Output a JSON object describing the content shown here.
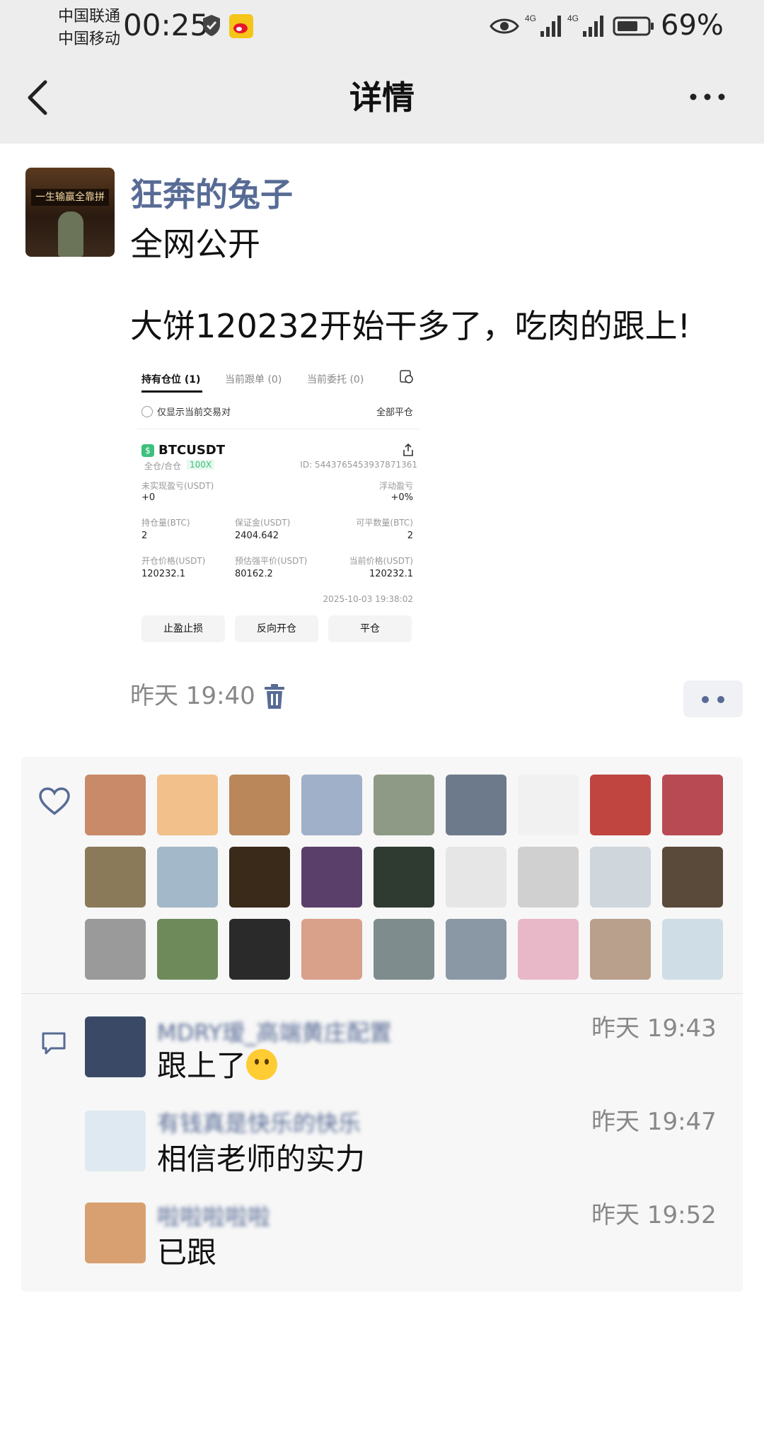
{
  "status_bar": {
    "carrier_1": "中国联通",
    "carrier_2": "中国移动",
    "time": "00:25",
    "network_1": "4G",
    "network_2": "4G",
    "battery": "69%"
  },
  "header": {
    "title": "详情"
  },
  "post": {
    "author": "狂奔的兔子",
    "avatar_sign_text": "一生输赢全靠拼",
    "visibility": "全网公开",
    "text": "大饼120232开始干多了，吃肉的跟上!",
    "time": "昨天 19:40"
  },
  "trade_screenshot": {
    "tabs": [
      "持有仓位 (1)",
      "当前跟单 (0)",
      "当前委托 (0)"
    ],
    "only_current_pair": "仅显示当前交易对",
    "close_all": "全部平仓",
    "symbol": "BTCUSDT",
    "margin_mode": "全仓/合仓",
    "leverage": "100X",
    "position_id": "ID: 5443765453937871361",
    "unrealized_pnl_label": "未实现盈亏(USDT)",
    "unrealized_pnl_value": "+0",
    "floating_pnl_label": "浮动盈亏",
    "floating_pnl_value": "+0%",
    "position_size_label": "持仓量(BTC)",
    "position_size_value": "2",
    "margin_label": "保证金(USDT)",
    "margin_value": "2404.642",
    "closable_label": "可平数量(BTC)",
    "closable_value": "2",
    "entry_price_label": "开仓价格(USDT)",
    "entry_price_value": "120232.1",
    "liq_price_label": "预估强平价(USDT)",
    "liq_price_value": "80162.2",
    "mark_price_label": "当前价格(USDT)",
    "mark_price_value": "120232.1",
    "timestamp": "2025-10-03 19:38:02",
    "buttons": [
      "止盈止损",
      "反向开仓",
      "平仓"
    ]
  },
  "likes": {
    "avatar_colors": [
      "#c98a6a",
      "#f2c08a",
      "#b9875a",
      "#9fb0c8",
      "#8f9a86",
      "#6d7a8c",
      "#f1f1f1",
      "#c0443f",
      "#b84a54",
      "#8a7a5a",
      "#a3b8c8",
      "#3a2a1a",
      "#5b3f6b",
      "#2f3a30",
      "#e6e6e6",
      "#d0d0d0",
      "#cfd6dc",
      "#5a4a3a",
      "#9a9a9a",
      "#6f8a5a",
      "#2a2a2a",
      "#d9a08a",
      "#7f8c8d",
      "#8a98a6",
      "#e8b8c8",
      "#b9a08c",
      "#cfdde6"
    ]
  },
  "comments": [
    {
      "name": "MDRY瑷_高端黄庄配置",
      "time": "昨天 19:43",
      "text": "跟上了",
      "avatar_color": "#3a4a66"
    },
    {
      "name": "有钱真是快乐的快乐",
      "time": "昨天 19:47",
      "text": "相信老师的实力",
      "avatar_color": "#dfe9f1"
    },
    {
      "name": "啦啦啦啦啦",
      "time": "昨天 19:52",
      "text": "已跟",
      "avatar_color": "#d8a070"
    }
  ],
  "colors": {
    "link_blue": "#576b95",
    "topbar_bg": "#ededed",
    "panel_bg": "#f7f7f7"
  },
  "icons": [
    "back-arrow-icon",
    "more-icon",
    "shield-icon",
    "weibo-icon",
    "eye-icon",
    "signal-icon",
    "battery-icon",
    "delete-icon",
    "heart-icon",
    "comment-icon",
    "share-icon",
    "history-icon"
  ]
}
